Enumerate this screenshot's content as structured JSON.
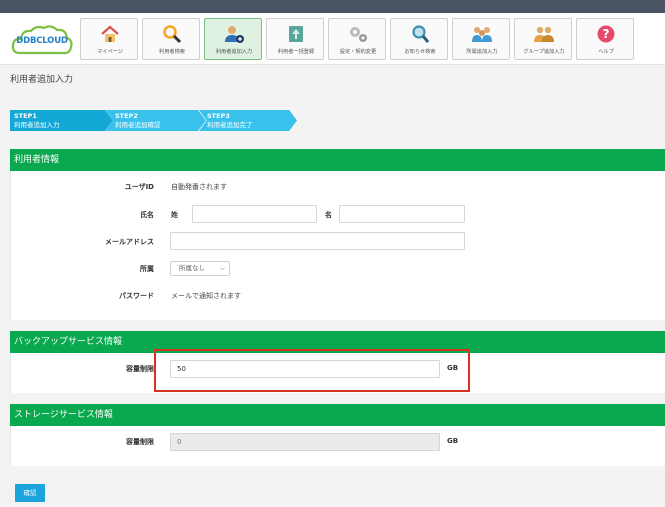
{
  "app": {
    "logo_text": "DDBCLOUD"
  },
  "nav": [
    {
      "label": "マイページ",
      "icon": "home-icon"
    },
    {
      "label": "利用者検索",
      "icon": "search-user-icon"
    },
    {
      "label": "利用者追加入力",
      "icon": "add-user-icon",
      "active": true
    },
    {
      "label": "利用者一括登録",
      "icon": "upload-icon"
    },
    {
      "label": "設定・契約変更",
      "icon": "gear-icon"
    },
    {
      "label": "お知らせ検索",
      "icon": "search-notice-icon"
    },
    {
      "label": "所属追加入力",
      "icon": "add-group-icon"
    },
    {
      "label": "グループ追加入力",
      "icon": "add-users-group-icon"
    },
    {
      "label": "ヘルプ",
      "icon": "help-icon"
    }
  ],
  "page": {
    "title": "利用者追加入力"
  },
  "steps": [
    {
      "step": "STEP1",
      "label": "利用者追加入力"
    },
    {
      "step": "STEP2",
      "label": "利用者追加確認"
    },
    {
      "step": "STEP3",
      "label": "利用者追加完了"
    }
  ],
  "user_info": {
    "title": "利用者情報",
    "user_id_label": "ユーザID",
    "user_id_value": "自動発番されます",
    "name_label": "氏名",
    "last_name_label": "姓",
    "last_name_value": "",
    "first_name_label": "名",
    "first_name_value": "",
    "email_label": "メールアドレス",
    "email_value": "",
    "affiliation_label": "所属",
    "affiliation_value": "所属なし",
    "password_label": "パスワード",
    "password_value": "メールで通知されます"
  },
  "backup": {
    "title": "バックアップサービス情報",
    "capacity_label": "容量制限",
    "capacity_value": "50",
    "unit": "GB"
  },
  "storage": {
    "title": "ストレージサービス情報",
    "capacity_label": "容量制限",
    "capacity_value": "0",
    "unit": "GB"
  },
  "actions": {
    "confirm_label": "確認"
  },
  "colors": {
    "topbar": "#4b5563",
    "section_green": "#0aa84f",
    "step_blue": "#14a8d6",
    "step_light_blue": "#39c1ec",
    "highlight_red": "#d93025"
  }
}
